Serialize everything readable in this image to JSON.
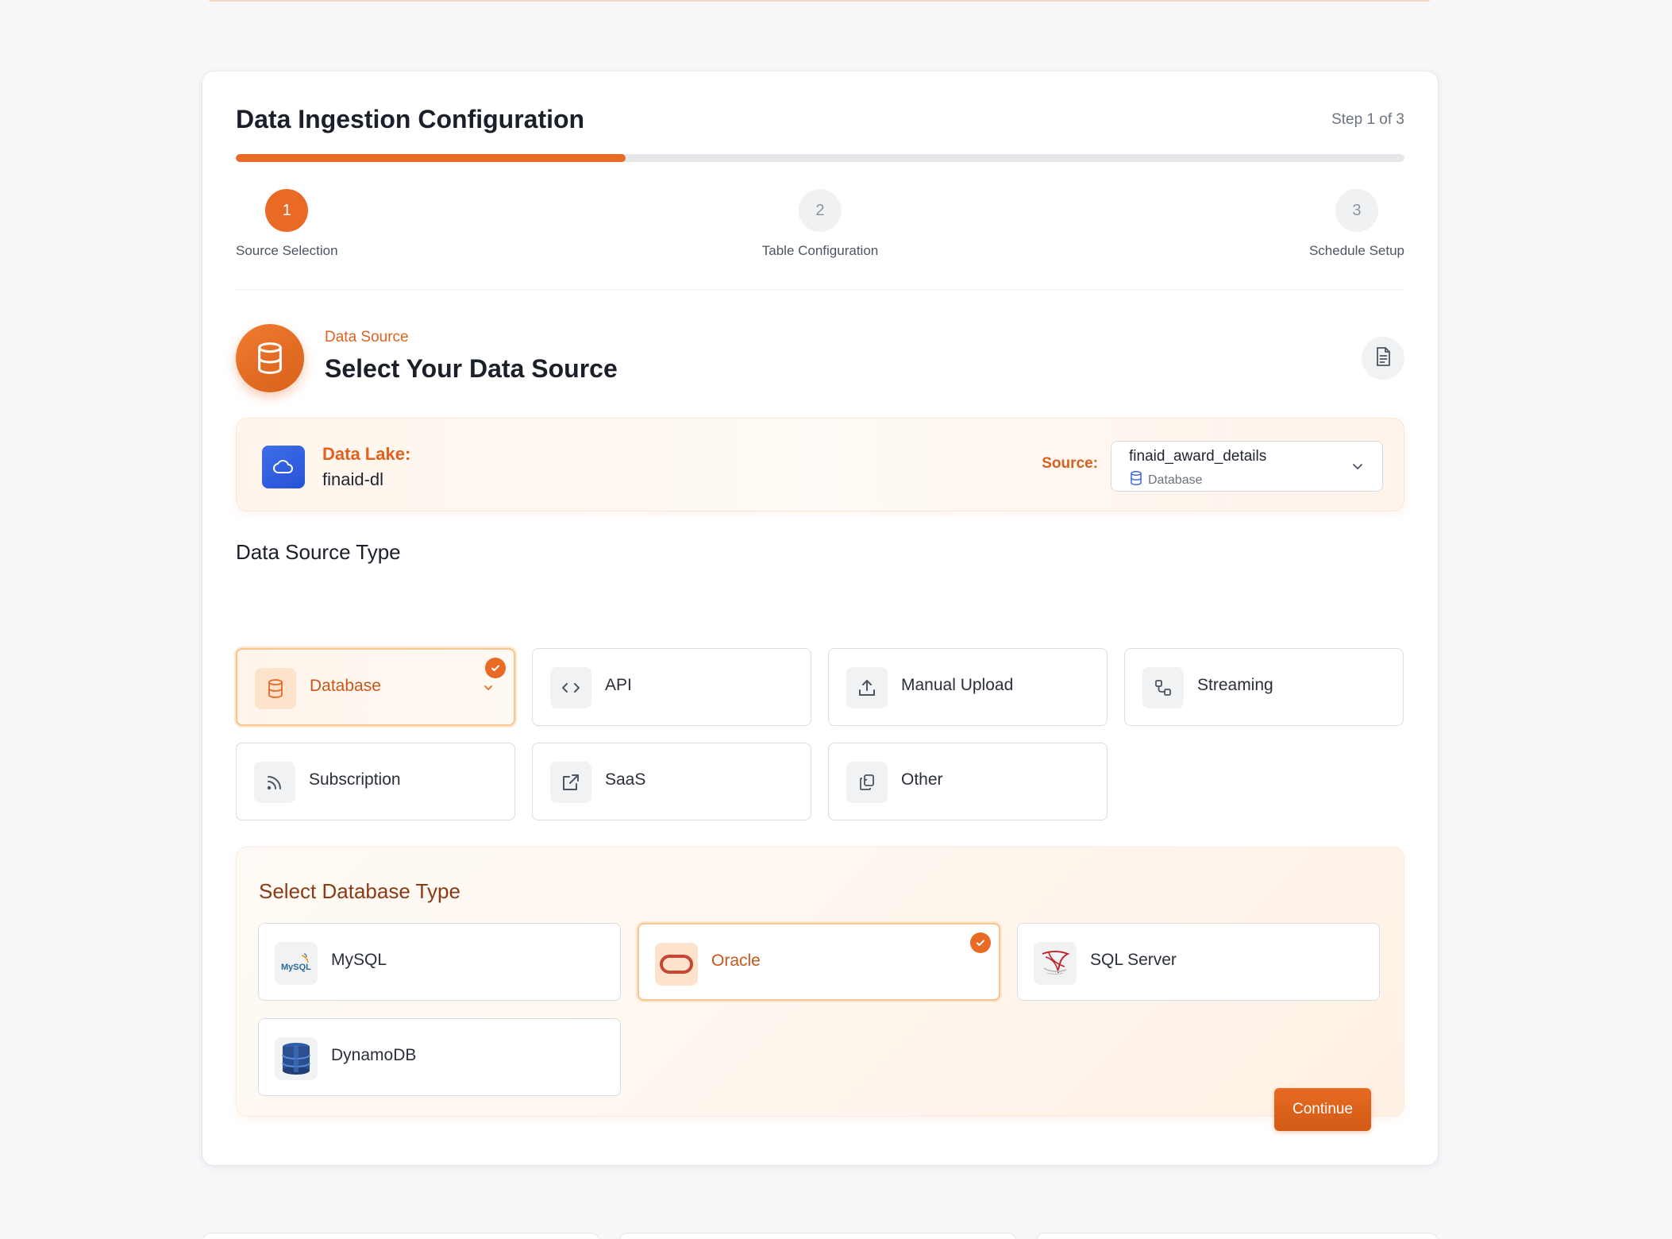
{
  "header": {
    "title": "Data Ingestion Configuration",
    "step_count": "Step 1 of 3",
    "progress_fraction": 0.3333
  },
  "steps": [
    {
      "number": "1",
      "label": "Source Selection",
      "active": true
    },
    {
      "number": "2",
      "label": "Table Configuration",
      "active": false
    },
    {
      "number": "3",
      "label": "Schedule Setup",
      "active": false
    }
  ],
  "source_section": {
    "kicker": "Data Source",
    "title": "Select Your Data Source",
    "icon": "database-icon",
    "doc_icon": "document-icon"
  },
  "data_lake": {
    "label": "Data Lake:",
    "value": "finaid-dl",
    "icon": "cloud-icon",
    "source_label": "Source:",
    "source_value": "finaid_award_details",
    "source_type": "Database"
  },
  "data_source_type": {
    "label": "Data Source Type",
    "options": [
      {
        "label": "Database",
        "icon": "database-icon",
        "selected": true
      },
      {
        "label": "API",
        "icon": "code-icon",
        "selected": false
      },
      {
        "label": "Manual Upload",
        "icon": "upload-icon",
        "selected": false
      },
      {
        "label": "Streaming",
        "icon": "streaming-icon",
        "selected": false
      },
      {
        "label": "Subscription",
        "icon": "rss-icon",
        "selected": false
      },
      {
        "label": "SaaS",
        "icon": "external-link-icon",
        "selected": false
      },
      {
        "label": "Other",
        "icon": "copy-icon",
        "selected": false
      }
    ]
  },
  "database_type": {
    "title": "Select Database Type",
    "options": [
      {
        "label": "MySQL",
        "icon": "mysql-logo-icon",
        "logo_text": "MySQL",
        "selected": false
      },
      {
        "label": "Oracle",
        "icon": "oracle-logo-icon",
        "selected": true
      },
      {
        "label": "SQL Server",
        "icon": "sql-server-logo-icon",
        "selected": false
      },
      {
        "label": "DynamoDB",
        "icon": "dynamodb-logo-icon",
        "selected": false
      }
    ]
  },
  "actions": {
    "continue_label": "Continue"
  },
  "colors": {
    "accent": "#e86a25",
    "accent_dark": "#d35b16",
    "lake_blue": "#2f5fe0",
    "heading_brown": "#8a3a14"
  }
}
